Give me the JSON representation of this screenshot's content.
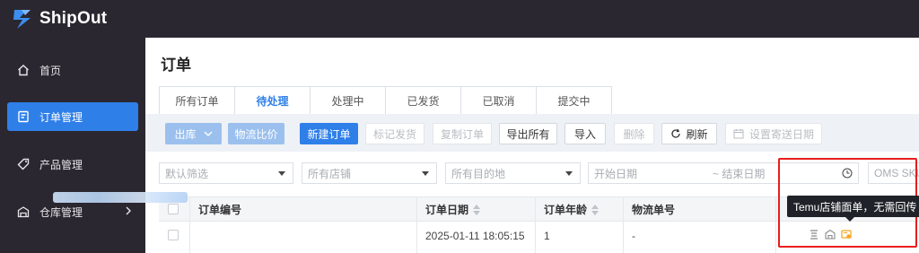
{
  "app": {
    "logo_text": "ShipOut"
  },
  "sidebar": {
    "items": [
      {
        "label": "首页",
        "icon": "home-icon",
        "active": false
      },
      {
        "label": "订单管理",
        "icon": "orders-icon",
        "active": true
      },
      {
        "label": "产品管理",
        "icon": "tag-icon",
        "active": false
      },
      {
        "label": "仓库管理",
        "icon": "warehouse-icon",
        "active": false
      }
    ]
  },
  "page": {
    "title": "订单"
  },
  "tabs": [
    {
      "label": "所有订单"
    },
    {
      "label": "待处理"
    },
    {
      "label": "处理中"
    },
    {
      "label": "已发货"
    },
    {
      "label": "已取消"
    },
    {
      "label": "提交中"
    }
  ],
  "toolbar": {
    "outbound": "出库",
    "compare": "物流比价",
    "new_order": "新建订单",
    "mark_shipped": "标记发货",
    "copy_order": "复制订单",
    "export_all": "导出所有",
    "import": "导入",
    "delete": "删除",
    "refresh": "刷新",
    "set_ship_date": "设置寄送日期"
  },
  "filters": {
    "default_filter": "默认筛选",
    "all_stores": "所有店铺",
    "all_destinations": "所有目的地",
    "start_date": "开始日期",
    "end_date": "~ 结束日期",
    "oms_sku": "OMS SKU"
  },
  "table": {
    "columns": [
      "订单编号",
      "订单日期",
      "订单年龄",
      "物流单号"
    ],
    "rows": [
      {
        "order_date": "2025-01-11 18:05:15",
        "order_age": "1",
        "tracking_no": "-"
      }
    ]
  },
  "tooltip": {
    "text": "Temu店铺面单，无需回传"
  },
  "colors": {
    "accent": "#2f7fe8",
    "sidebar_bg": "#2b2730",
    "highlight": "#e81d1d",
    "warning_icon": "#f5a623"
  }
}
